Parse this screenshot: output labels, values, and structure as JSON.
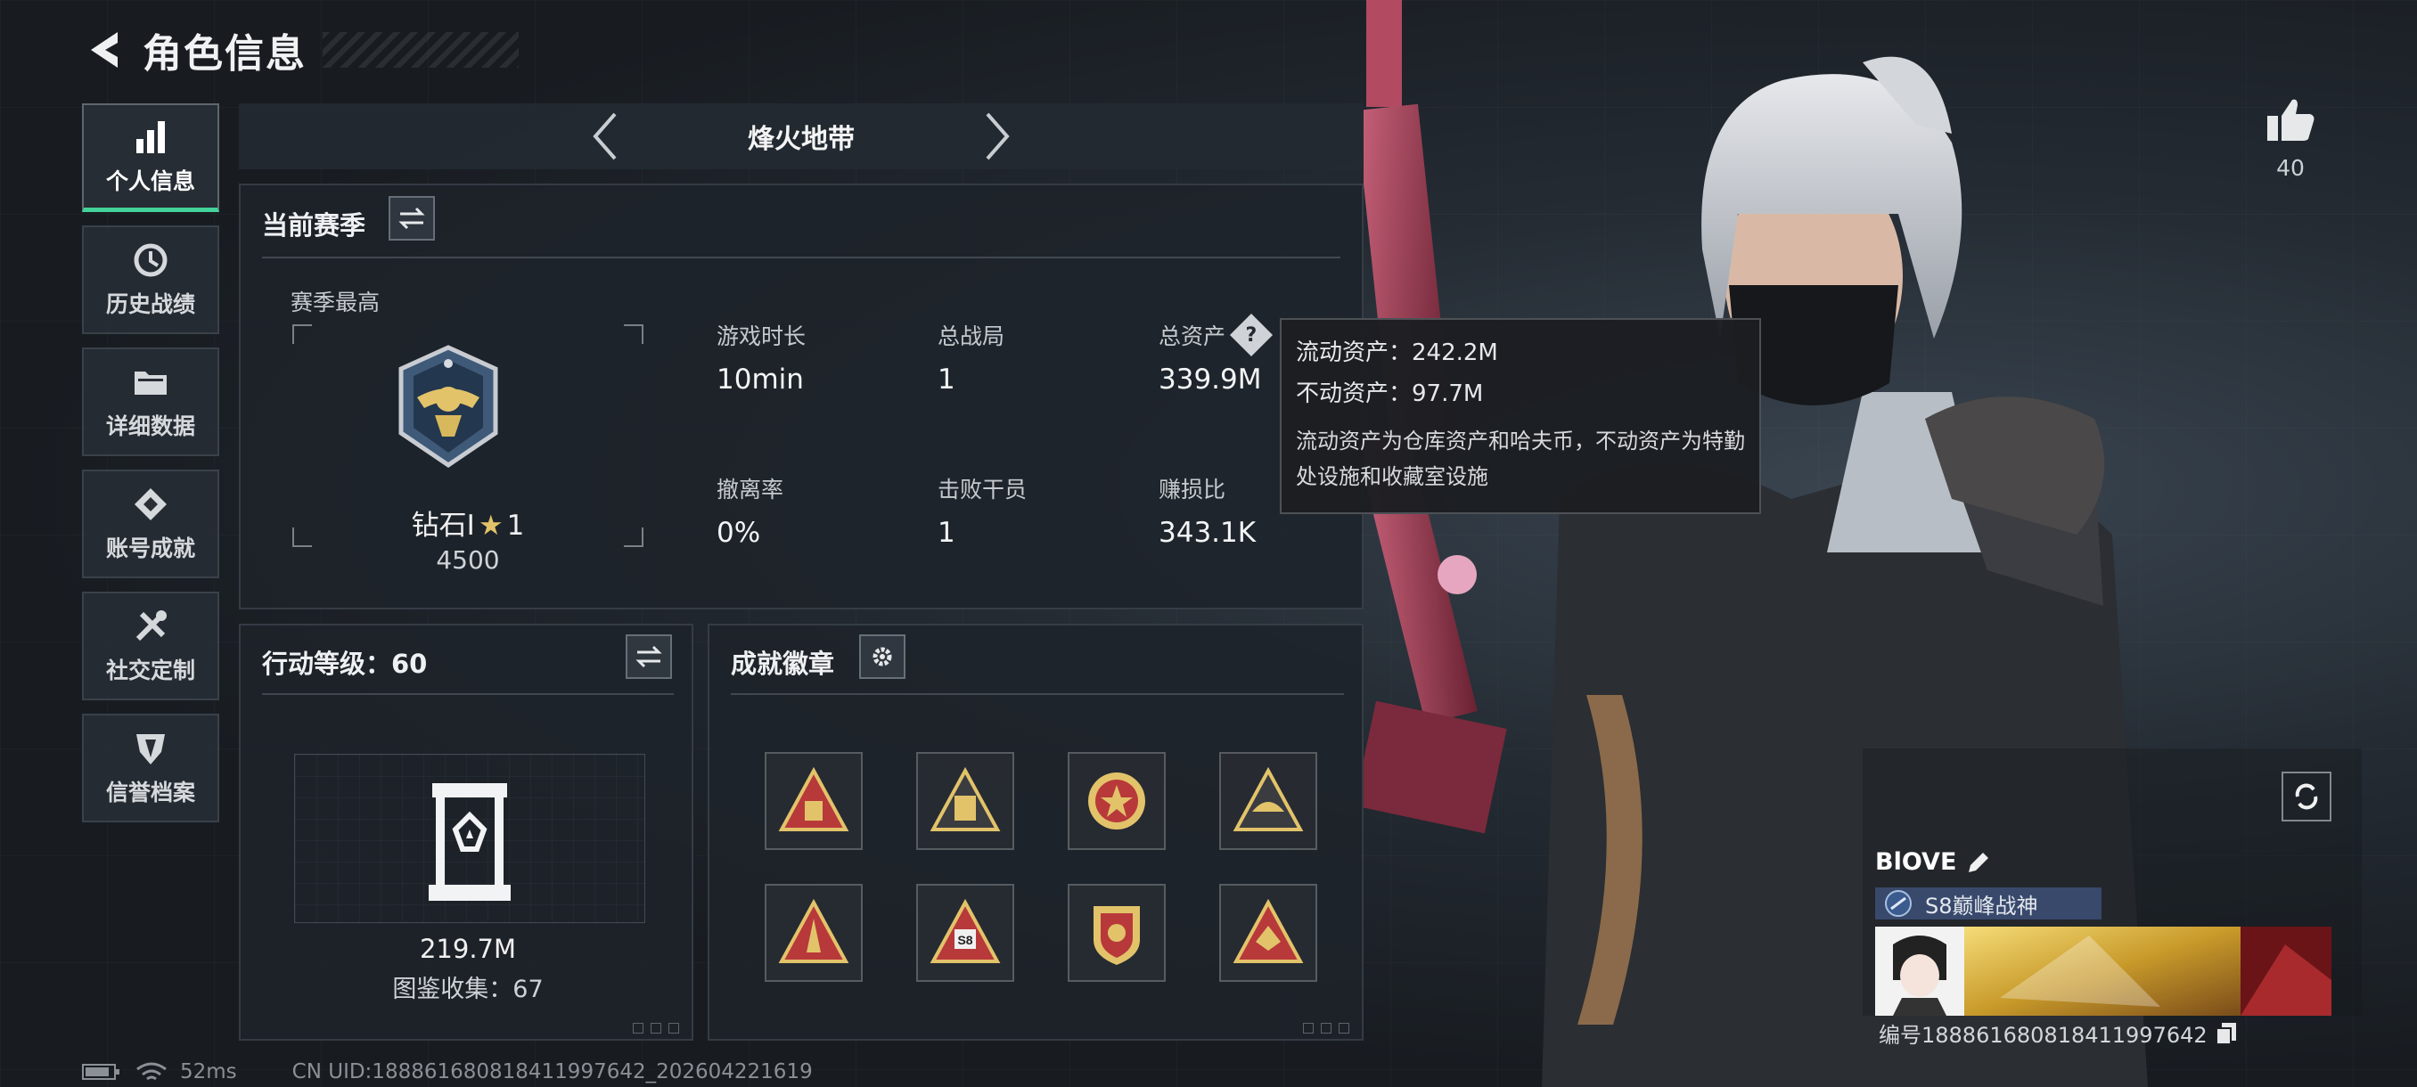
{
  "header": {
    "title": "角色信息"
  },
  "sidebar": {
    "items": [
      {
        "label": "个人信息",
        "icon": "bar-chart-icon",
        "active": true
      },
      {
        "label": "历史战绩",
        "icon": "history-icon"
      },
      {
        "label": "详细数据",
        "icon": "folder-icon"
      },
      {
        "label": "账号成就",
        "icon": "achievement-icon"
      },
      {
        "label": "社交定制",
        "icon": "tools-icon"
      },
      {
        "label": "信誉档案",
        "icon": "credit-icon"
      }
    ]
  },
  "mode": {
    "name": "烽火地带"
  },
  "season": {
    "title": "当前赛季",
    "best_label": "赛季最高",
    "rank_name": "钻石I",
    "rank_stars": "1",
    "rank_score": "4500",
    "stats": [
      {
        "label": "游戏时长",
        "value": "10min"
      },
      {
        "label": "总战局",
        "value": "1"
      },
      {
        "label": "总资产",
        "value": "339.9M"
      },
      {
        "label": "撤离率",
        "value": "0%"
      },
      {
        "label": "击败干员",
        "value": "1"
      },
      {
        "label": "赚损比",
        "value": "343.1K"
      }
    ]
  },
  "tooltip": {
    "liquid": "流动资产：242.2M",
    "fixed": "不动资产：97.7M",
    "desc": "流动资产为仓库资产和哈夫币，不动资产为特勤处设施和收藏室设施"
  },
  "action": {
    "title": "行动等级：60",
    "value": "219.7M",
    "collect": "图鉴收集：67"
  },
  "achieve": {
    "title": "成就徽章",
    "badge_badge_text": "S8"
  },
  "player": {
    "likes": "40",
    "name": "BlOVE",
    "title": "S8巅峰战神",
    "id": "编号1888616808184119976​42"
  },
  "status": {
    "ping": "52ms",
    "uid": "CN UID:188861680818411997642_202604221619"
  },
  "colors": {
    "accent": "#43d39a",
    "gold": "#e2c36a"
  }
}
